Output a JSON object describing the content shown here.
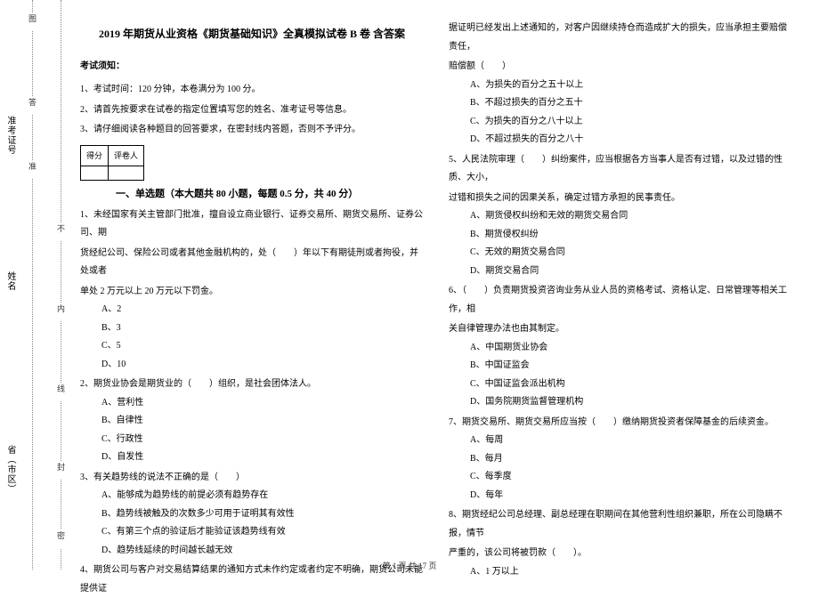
{
  "sidebar": {
    "outer_markers": [
      "图",
      "答",
      "准"
    ],
    "inner_markers": [
      "不",
      "内",
      "线",
      "封",
      "密"
    ],
    "fields": {
      "exam_id_label": "准考证号",
      "name_label": "姓名",
      "region_label": "省（市区）"
    }
  },
  "header": {
    "title": "2019 年期货从业资格《期货基础知识》全真模拟试卷 B 卷 含答案",
    "notice_label": "考试须知：",
    "notice_1": "1、考试时间：120 分钟，本卷满分为 100 分。",
    "notice_2": "2、请首先按要求在试卷的指定位置填写您的姓名、准考证号等信息。",
    "notice_3": "3、请仔细阅读各种题目的回答要求，在密封线内答题，否则不予评分。"
  },
  "score_table": {
    "h1": "得分",
    "h2": "评卷人"
  },
  "section1": {
    "title": "一、单选题（本大题共 80 小题，每题 0.5 分，共 40 分）"
  },
  "q1": {
    "stem_a": "1、未经国家有关主管部门批准，擅自设立商业银行、证券交易所、期货交易所、证券公司、期",
    "stem_b": "货经纪公司、保险公司或者其他金融机构的，处（　　）年以下有期徒刑或者拘役，并处或者",
    "stem_c": "单处 2 万元以上 20 万元以下罚金。",
    "a": "A、2",
    "b": "B、3",
    "c": "C、5",
    "d": "D、10"
  },
  "q2": {
    "stem": "2、期货业协会是期货业的（　　）组织，是社会团体法人。",
    "a": "A、营利性",
    "b": "B、自律性",
    "c": "C、行政性",
    "d": "D、自发性"
  },
  "q3": {
    "stem": "3、有关趋势线的说法不正确的是（　　）",
    "a": "A、能够成为趋势线的前提必须有趋势存在",
    "b": "B、趋势线被触及的次数多少可用于证明其有效性",
    "c": "C、有第三个点的验证后才能验证该趋势线有效",
    "d": "D、趋势线延续的时间越长越无效"
  },
  "q4": {
    "stem": "4、期货公司与客户对交易结算结果的通知方式未作约定或者约定不明确，期货公司未能提供证"
  },
  "q4_cont": {
    "line1": "据证明已经发出上述通知的，对客户因继续持仓而造成扩大的损失，应当承担主要赔偿责任，",
    "line2": "赔偿额（　　）",
    "a": "A、为损失的百分之五十以上",
    "b": "B、不超过损失的百分之五十",
    "c": "C、为损失的百分之八十以上",
    "d": "D、不超过损失的百分之八十"
  },
  "q5": {
    "stem_a": "5、人民法院审理（　　）纠纷案件，应当根据各方当事人是否有过错，以及过错的性质、大小，",
    "stem_b": "过错和损失之间的因果关系，确定过错方承担的民事责任。",
    "a": "A、期货侵权纠纷和无效的期货交易合同",
    "b": "B、期货侵权纠纷",
    "c": "C、无效的期货交易合同",
    "d": "D、期货交易合同"
  },
  "q6": {
    "stem_a": "6、（　　）负责期货投资咨询业务从业人员的资格考试、资格认定、日常管理等相关工作，相",
    "stem_b": "关自律管理办法也由其制定。",
    "a": "A、中国期货业协会",
    "b": "B、中国证监会",
    "c": "C、中国证监会派出机构",
    "d": "D、国务院期货监督管理机构"
  },
  "q7": {
    "stem": "7、期货交易所、期货交易所应当按（　　）缴纳期货投资者保障基金的后续资金。",
    "a": "A、每周",
    "b": "B、每月",
    "c": "C、每季度",
    "d": "D、每年"
  },
  "q8": {
    "stem_a": "8、期货经纪公司总经理、副总经理在职期间在其他营利性组织兼职，所在公司隐瞒不报，情节",
    "stem_b": "严重的，该公司将被罚款（　　）。",
    "a": "A、1 万以上"
  },
  "footer": {
    "text": "第 1 页 共 17 页"
  }
}
